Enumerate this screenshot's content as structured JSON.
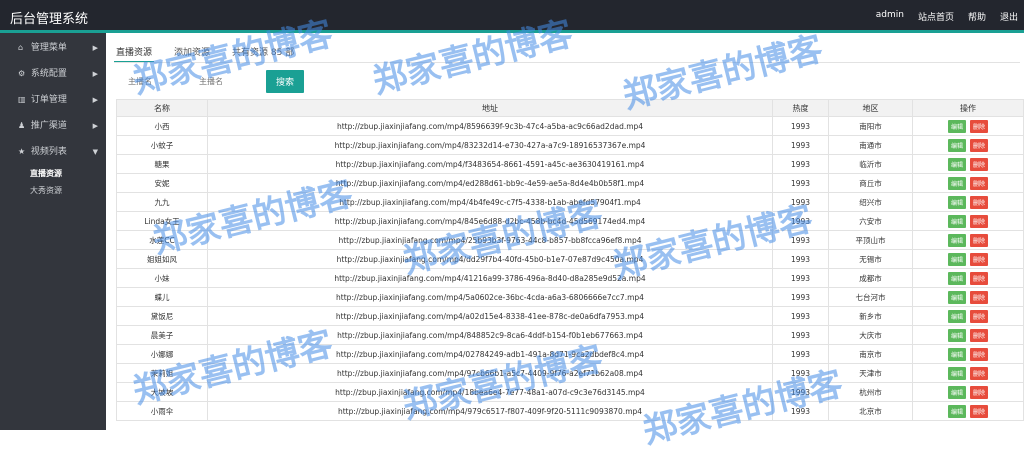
{
  "header": {
    "app_title": "后台管理系统",
    "links": [
      "admin",
      "站点首页",
      "帮助",
      "退出"
    ]
  },
  "sidebar": {
    "items": [
      {
        "icon": "home-icon",
        "glyph": "⌂",
        "label": "管理菜单"
      },
      {
        "icon": "gear-icon",
        "glyph": "⚙",
        "label": "系统配置"
      },
      {
        "icon": "bar-chart-icon",
        "glyph": "▥",
        "label": "订单管理"
      },
      {
        "icon": "user-icon",
        "glyph": "♟",
        "label": "推广渠道"
      },
      {
        "icon": "star-icon",
        "glyph": "★",
        "label": "视频列表"
      }
    ],
    "subitems": [
      {
        "label": "直播资源",
        "active": true
      },
      {
        "label": "大秀资源",
        "active": false
      }
    ]
  },
  "tabs": [
    {
      "label": "直播资源",
      "active": true
    },
    {
      "label": "添加资源",
      "active": false
    },
    {
      "label": "共有资源 85 部",
      "active": false
    }
  ],
  "search": {
    "placeholder1": "主播名",
    "placeholder2": "主播名",
    "button": "搜索"
  },
  "table": {
    "headers": [
      "名称",
      "地址",
      "热度",
      "地区",
      "操作"
    ],
    "edit_label": "编辑",
    "delete_label": "删除",
    "rows": [
      {
        "name": "小西",
        "url": "http://zbup.jiaxinjiafang.com/mp4/8596639f-9c3b-47c4-a5ba-ac9c66ad2dad.mp4",
        "heat": "1993",
        "region": "南阳市"
      },
      {
        "name": "小蚊子",
        "url": "http://zbup.jiaxinjiafang.com/mp4/83232d14-e730-427a-a7c9-18916537367e.mp4",
        "heat": "1993",
        "region": "南通市"
      },
      {
        "name": "糖果",
        "url": "http://zbup.jiaxinjiafang.com/mp4/f3483654-8661-4591-a45c-ae3630419161.mp4",
        "heat": "1993",
        "region": "临沂市"
      },
      {
        "name": "安妮",
        "url": "http://zbup.jiaxinjiafang.com/mp4/ed288d61-bb9c-4e59-ae5a-8d4e4b0b58f1.mp4",
        "heat": "1993",
        "region": "商丘市"
      },
      {
        "name": "九九",
        "url": "http://zbup.jiaxinjiafang.com/mp4/4b4fe49c-c7f5-4338-b1ab-abefd57904f1.mp4",
        "heat": "1993",
        "region": "绍兴市"
      },
      {
        "name": "Linda女王",
        "url": "http://zbup.jiaxinjiafang.com/mp4/845e6d88-d2bc-458b-bc4d-45d569174ed4.mp4",
        "heat": "1993",
        "region": "六安市"
      },
      {
        "name": "水莲CC",
        "url": "http://zbup.jiaxinjiafang.com/mp4/25b93b3f-9763-44c8-b857-bb8fcca96ef8.mp4",
        "heat": "1993",
        "region": "平顶山市"
      },
      {
        "name": "姐姐如风",
        "url": "http://zbup.jiaxinjiafang.com/mp4/dd29f7b4-40fd-45b0-b1e7-07e87d9c450a.mp4",
        "heat": "1993",
        "region": "无锡市"
      },
      {
        "name": "小妹",
        "url": "http://zbup.jiaxinjiafang.com/mp4/41216a99-3786-496a-8d40-d8a285e9d52a.mp4",
        "heat": "1993",
        "region": "成都市"
      },
      {
        "name": "蝶儿",
        "url": "http://zbup.jiaxinjiafang.com/mp4/5a0602ce-36bc-4cda-a6a3-6806666e7cc7.mp4",
        "heat": "1993",
        "region": "七台河市"
      },
      {
        "name": "黛饭尼",
        "url": "http://zbup.jiaxinjiafang.com/mp4/a02d15e4-8338-41ee-878c-de0a6dfa7953.mp4",
        "heat": "1993",
        "region": "新乡市"
      },
      {
        "name": "晨美子",
        "url": "http://zbup.jiaxinjiafang.com/mp4/848852c9-8ca6-4ddf-b154-f0b1eb677663.mp4",
        "heat": "1993",
        "region": "大庆市"
      },
      {
        "name": "小娜娜",
        "url": "http://zbup.jiaxinjiafang.com/mp4/02784249-adb1-491a-8d71-9ca2dbdef8c4.mp4",
        "heat": "1993",
        "region": "南京市"
      },
      {
        "name": "茉莉姐",
        "url": "http://zbup.jiaxinjiafang.com/mp4/97cb66b1-a5c7-4409-9f76-a2ef71b62a08.mp4",
        "heat": "1993",
        "region": "天津市"
      },
      {
        "name": "大坡坡",
        "url": "http://zbup.jiaxinjiafang.com/mp4/18bea6e4-7e77-48a1-a07d-c9c3e76d3145.mp4",
        "heat": "1993",
        "region": "杭州市"
      },
      {
        "name": "小雨伞",
        "url": "http://zbup.jiaxinjiafang.com/mp4/979c6517-f807-409f-9f20-5111c9093870.mp4",
        "heat": "1993",
        "region": "北京市"
      }
    ]
  },
  "watermark": "郑家喜的博客"
}
